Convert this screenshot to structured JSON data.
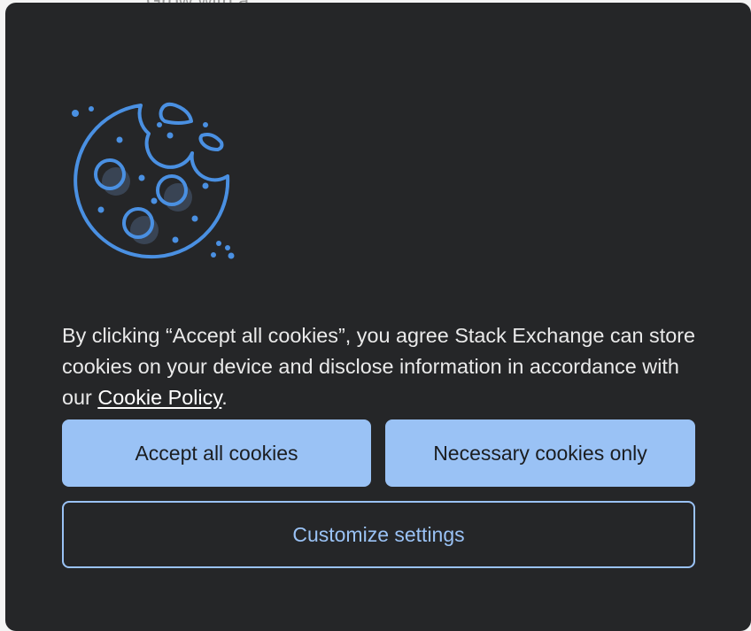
{
  "background": {
    "peek_text": "Grow with a"
  },
  "cookie_banner": {
    "icon": "cookie-icon",
    "message_prefix": "By clicking “Accept all cookies”, you agree Stack Exchange can store cookies on your device and disclose information in accordance with our ",
    "policy_link": "Cookie Policy",
    "message_suffix": ".",
    "accept_label": "Accept all cookies",
    "necessary_label": "Necessary cookies only",
    "customize_label": "Customize settings"
  },
  "colors": {
    "dialog_bg": "#252628",
    "accent": "#9ac2f5",
    "icon_stroke": "#4a90e2",
    "text": "#eaeaea"
  }
}
